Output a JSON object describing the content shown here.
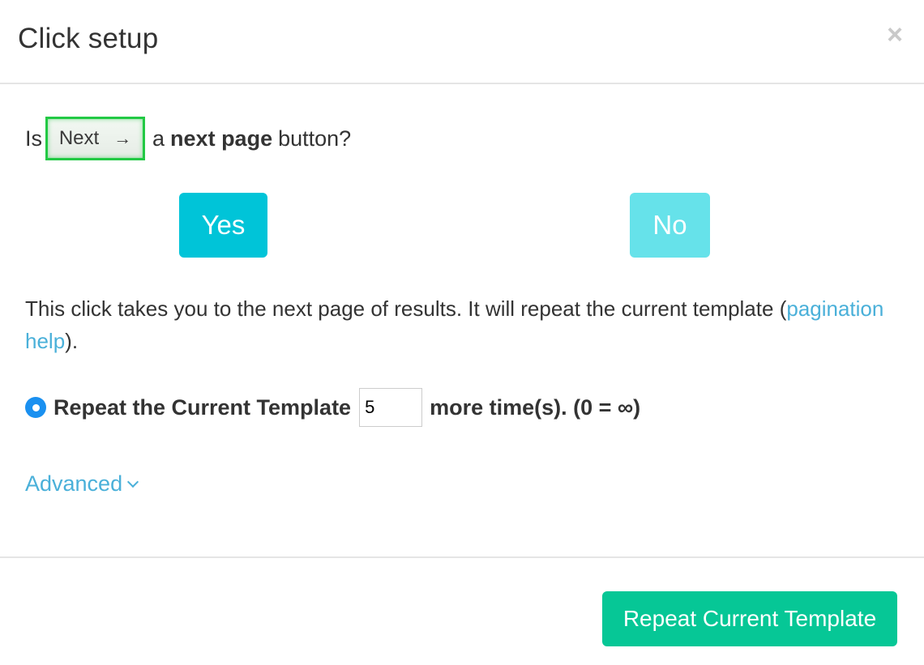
{
  "dialog": {
    "title": "Click setup",
    "close_icon": "close-icon"
  },
  "question": {
    "prefix": "Is",
    "preview_label": "Next",
    "preview_arrow": "→",
    "middle": "a",
    "bold": "next page",
    "suffix": "button?"
  },
  "buttons": {
    "yes": "Yes",
    "no": "No",
    "repeat_current_template": "Repeat Current Template"
  },
  "description": {
    "text": "This click takes you to the next page of results. It will repeat the current template",
    "open_paren": "(",
    "link": "pagination help",
    "close_paren": ")."
  },
  "repeat": {
    "label": "Repeat the Current Template",
    "value": "5",
    "suffix": "more time(s). (0 = ∞)",
    "selected": true
  },
  "advanced": {
    "label": "Advanced"
  },
  "colors": {
    "yes_button": "#00c4d8",
    "no_button": "#66e2ea",
    "primary_button": "#06c796",
    "link": "#4ab0d9",
    "radio": "#1a90f0",
    "highlight_border": "#22c944"
  }
}
